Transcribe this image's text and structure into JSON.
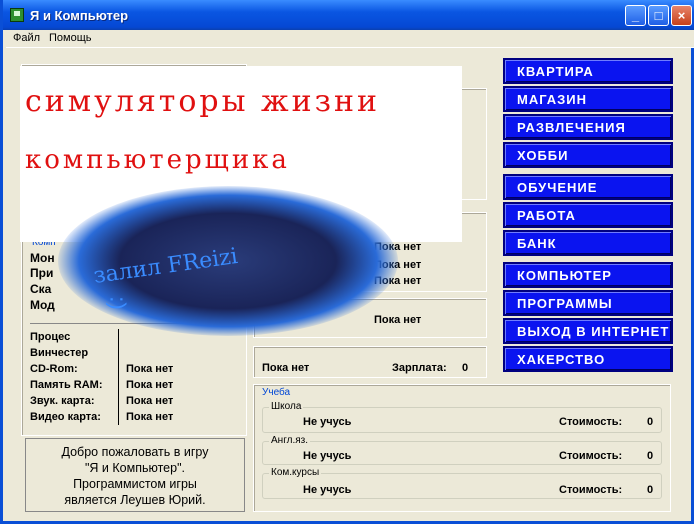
{
  "window": {
    "title": "Я и Компьютер"
  },
  "menu": {
    "items": [
      "Файл",
      "Помощь"
    ]
  },
  "overlay": {
    "line1": "симуляторы жизни",
    "line2": "компьютерщика",
    "blob_text": "залил FReizi",
    "smile": ":)"
  },
  "left_panel": {
    "group_label": "Комп",
    "visible_labels": [
      "Мон",
      "При",
      "Ска",
      "Мод"
    ],
    "components": [
      {
        "label": "Процес",
        "value": ""
      },
      {
        "label": "Винчестер",
        "value": ""
      },
      {
        "label": "CD-Rom:",
        "value": "Пока нет"
      },
      {
        "label": "Память RAM:",
        "value": "Пока нет"
      },
      {
        "label": "Звук. карта:",
        "value": "Пока нет"
      },
      {
        "label": "Видео карта:",
        "value": "Пока нет"
      }
    ]
  },
  "mid_panel": {
    "values": [
      "Пока нет",
      "Пока нет",
      "Пока нет",
      "Пока нет",
      "Пока нет"
    ],
    "salary_label": "Зарплата:",
    "salary_value": "0"
  },
  "nav": {
    "buttons": [
      "КВАРТИРА",
      "МАГАЗИН",
      "РАЗВЛЕЧЕНИЯ",
      "ХОББИ",
      "ОБУЧЕНИЕ",
      "РАБОТА",
      "БАНК",
      "КОМПЬЮТЕР",
      "ПРОГРАММЫ",
      "ВЫХОД В ИНТЕРНЕТ",
      "ХАКЕРСТВО"
    ]
  },
  "study": {
    "title": "Учеба",
    "cost_label": "Стоимость:",
    "rows": [
      {
        "name": "Школа",
        "status": "Не учусь",
        "cost": "0"
      },
      {
        "name": "Англ.яз.",
        "status": "Не учусь",
        "cost": "0"
      },
      {
        "name": "Ком.курсы",
        "status": "Не учусь",
        "cost": "0"
      }
    ]
  },
  "welcome": {
    "text": [
      "Добро пожаловать в игру",
      "\"Я и Компьютер\".",
      "Программистом игры",
      "является Леушев Юрий."
    ]
  },
  "colors": {
    "nav_button": "#0a14f0",
    "titlebar": "#0a56e2",
    "scrawl": "#e01010"
  }
}
